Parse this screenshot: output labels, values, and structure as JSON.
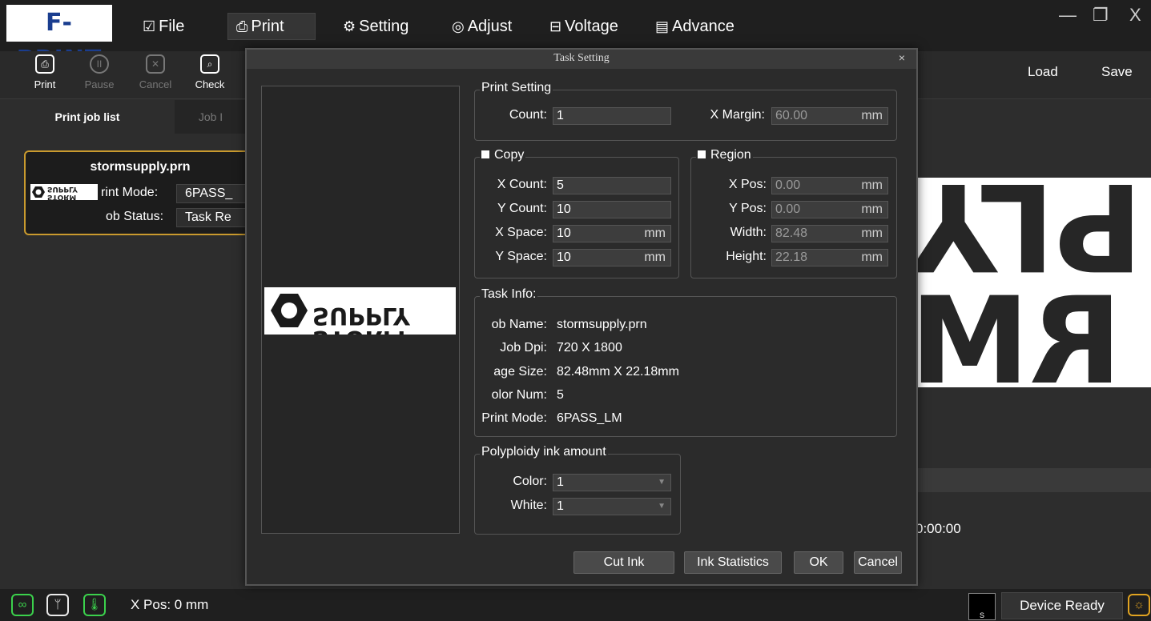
{
  "app": {
    "logo": "F-PRINT",
    "menu": [
      {
        "label": "File",
        "icon": "document-check-icon"
      },
      {
        "label": "Print",
        "icon": "printer-icon"
      },
      {
        "label": "Setting",
        "icon": "gear-icon"
      },
      {
        "label": "Adjust",
        "icon": "adjust-icon"
      },
      {
        "label": "Voltage",
        "icon": "voltage-icon"
      },
      {
        "label": "Advance",
        "icon": "advance-icon"
      }
    ],
    "window_controls": {
      "minimize": "—",
      "restore": "❐",
      "close": "X"
    }
  },
  "toolbar": {
    "print": "Print",
    "pause": "Pause",
    "cancel": "Cancel",
    "check": "Check",
    "load": "Load",
    "save": "Save"
  },
  "left_panel": {
    "tabs": [
      "Print job list",
      "Job I"
    ],
    "job": {
      "name": "stormsupply.prn",
      "mode_label": "rint Mode:",
      "mode_value": "6PASS_",
      "status_label": "ob Status:",
      "status_value": "Task Re",
      "logo_text": "SUPPLY STORM"
    }
  },
  "preview": {
    "top_text": "PLY",
    "bottom_text": "RM",
    "timer": "0:00:00"
  },
  "dialog": {
    "title": "Task Setting",
    "close": "×",
    "thumb_logo_top": "SUPPLY",
    "thumb_logo_bottom": "STORM",
    "print_setting": {
      "title": "Print Setting",
      "count_label": "Count:",
      "count_value": "1",
      "xmargin_label": "X Margin:",
      "xmargin_value": "60.00",
      "unit": "mm"
    },
    "copy": {
      "title": "Copy",
      "checked": true,
      "xcount_label": "X Count:",
      "xcount_value": "5",
      "ycount_label": "Y Count:",
      "ycount_value": "10",
      "xspace_label": "X Space:",
      "xspace_value": "10",
      "yspace_label": "Y Space:",
      "yspace_value": "10",
      "unit": "mm"
    },
    "region": {
      "title": "Region",
      "checked": false,
      "xpos_label": "X Pos:",
      "xpos_value": "0.00",
      "ypos_label": "Y Pos:",
      "ypos_value": "0.00",
      "width_label": "Width:",
      "width_value": "82.48",
      "height_label": "Height:",
      "height_value": "22.18",
      "unit": "mm"
    },
    "task_info": {
      "title": "Task Info:",
      "rows": [
        {
          "label": "ob Name:",
          "value": "stormsupply.prn"
        },
        {
          "label": "Job Dpi:",
          "value": "720 X 1800"
        },
        {
          "label": "age Size:",
          "value": "82.48mm X 22.18mm"
        },
        {
          "label": "olor Num:",
          "value": "5"
        },
        {
          "label": "Print Mode:",
          "value": "6PASS_LM"
        }
      ]
    },
    "ink": {
      "title": "Polyploidy ink amount",
      "color_label": "Color:",
      "color_value": "1",
      "white_label": "White:",
      "white_value": "1"
    },
    "buttons": {
      "cut_ink": "Cut Ink",
      "ink_statistics": "Ink Statistics",
      "ok": "OK",
      "cancel": "Cancel"
    }
  },
  "statusbar": {
    "xpos": "X Pos: 0 mm",
    "ink_label": "S",
    "device_status": "Device Ready",
    "colors": {
      "ok": "#3bd14c",
      "warn": "#e0a321"
    }
  }
}
